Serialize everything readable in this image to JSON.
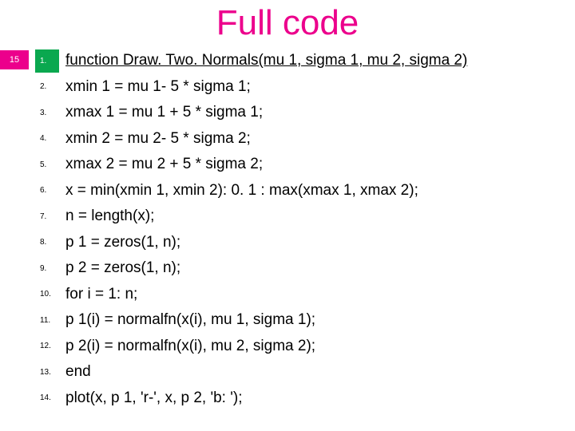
{
  "title": "Full code",
  "title_color": "#ec008c",
  "slide_number": "15",
  "lines": [
    {
      "n": "1.",
      "t": "function Draw. Two. Normals(mu 1, sigma 1, mu 2, sigma 2)"
    },
    {
      "n": "2.",
      "t": "xmin 1 = mu 1- 5 * sigma 1;"
    },
    {
      "n": "3.",
      "t": "xmax 1 = mu 1 + 5 * sigma 1;"
    },
    {
      "n": "4.",
      "t": "xmin 2 = mu 2- 5 * sigma 2;"
    },
    {
      "n": "5.",
      "t": "xmax 2 = mu 2 + 5 * sigma 2;"
    },
    {
      "n": "6.",
      "t": "x = min(xmin 1, xmin 2): 0. 1 : max(xmax 1, xmax 2);"
    },
    {
      "n": "7.",
      "t": "n = length(x);"
    },
    {
      "n": "8.",
      "t": "p 1 = zeros(1, n);"
    },
    {
      "n": "9.",
      "t": "p 2 = zeros(1, n);"
    },
    {
      "n": "10.",
      "t": "for i = 1: n;"
    },
    {
      "n": "11.",
      "t": "p 1(i) = normalfn(x(i), mu 1, sigma 1);"
    },
    {
      "n": "12.",
      "t": "p 2(i) = normalfn(x(i), mu 2, sigma 2);"
    },
    {
      "n": "13.",
      "t": "end"
    },
    {
      "n": "14.",
      "t": "plot(x, p 1, 'r-', x, p 2, 'b: ');"
    }
  ]
}
